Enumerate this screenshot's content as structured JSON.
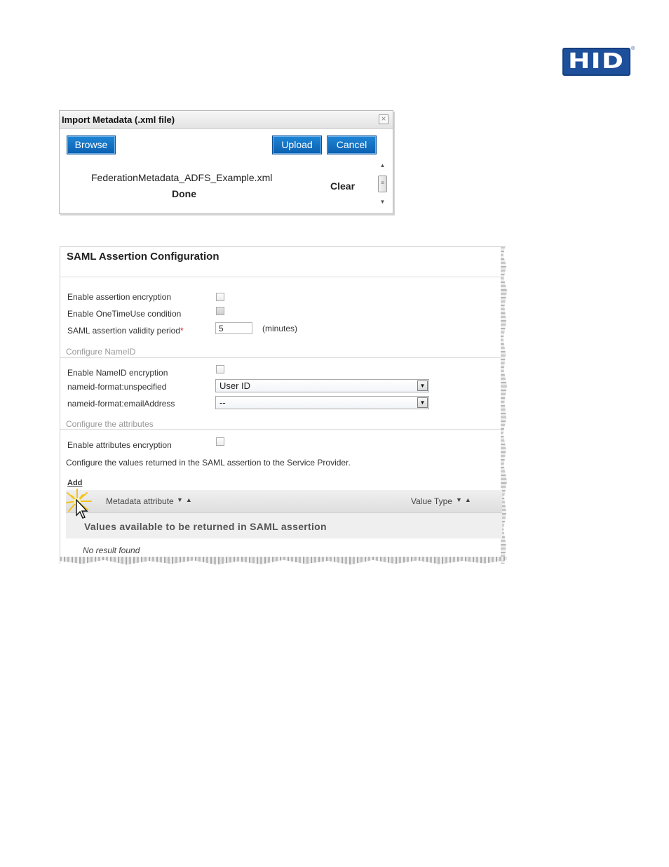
{
  "brand": {
    "logo_text": "HID",
    "logo_mark": "®",
    "color": "#1d4f9b"
  },
  "import_dialog": {
    "title": "Import Metadata (.xml file)",
    "browse_label": "Browse",
    "upload_label": "Upload",
    "cancel_label": "Cancel",
    "file_name": "FederationMetadata_ADFS_Example.xml",
    "file_status": "Done",
    "clear_label": "Clear",
    "button_color": "#0b6fc4"
  },
  "saml_config": {
    "title": "SAML Assertion Configuration",
    "enable_assertion_encryption": {
      "label": "Enable assertion encryption",
      "checked": false
    },
    "enable_onetimeuse": {
      "label": "Enable OneTimeUse condition",
      "checked": false
    },
    "validity_period": {
      "label": "SAML assertion validity period",
      "required_mark": "*",
      "value": "5",
      "unit": "(minutes)"
    },
    "nameid_section": "Configure NameID",
    "enable_nameid_encryption": {
      "label": "Enable NameID encryption",
      "checked": false
    },
    "nameid_unspecified": {
      "label": "nameid-format:unspecified",
      "value": "User ID"
    },
    "nameid_email": {
      "label": "nameid-format:emailAddress",
      "value": "--"
    },
    "attributes_section": "Configure the attributes",
    "enable_attributes_encryption": {
      "label": "Enable attributes encryption",
      "checked": false
    },
    "description": "Configure the values returned in the SAML assertion to the Service Provider.",
    "add_label": "Add",
    "grid": {
      "columns": [
        "Metadata attribute",
        "Value Type"
      ],
      "sort_glyphs": "▼▲",
      "group_label": "Values available to be returned in SAML assertion",
      "empty_text": "No result found"
    }
  }
}
